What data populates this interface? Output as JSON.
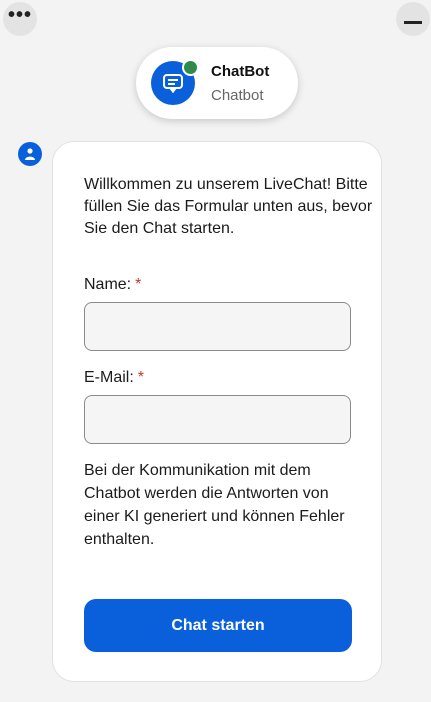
{
  "header": {
    "bot_name": "ChatBot",
    "bot_subtitle": "Chatbot",
    "status_color": "#2f8a4e",
    "accent_color": "#0a5fdb"
  },
  "controls": {
    "more_icon": "more-horizontal-icon",
    "minimize_icon": "minimize-icon"
  },
  "form": {
    "intro_text": "Willkommen zu unserem LiveChat! Bitte füllen Sie das Formular unten aus, bevor Sie den Chat starten.",
    "name_label": "Name:",
    "name_required": "*",
    "name_value": "",
    "email_label": "E-Mail:",
    "email_required": "*",
    "email_value": "",
    "disclaimer": "Bei der Kommunikation mit dem Chatbot werden die Antworten von einer KI generiert und können Fehler enthalten.",
    "submit_label": "Chat starten"
  }
}
